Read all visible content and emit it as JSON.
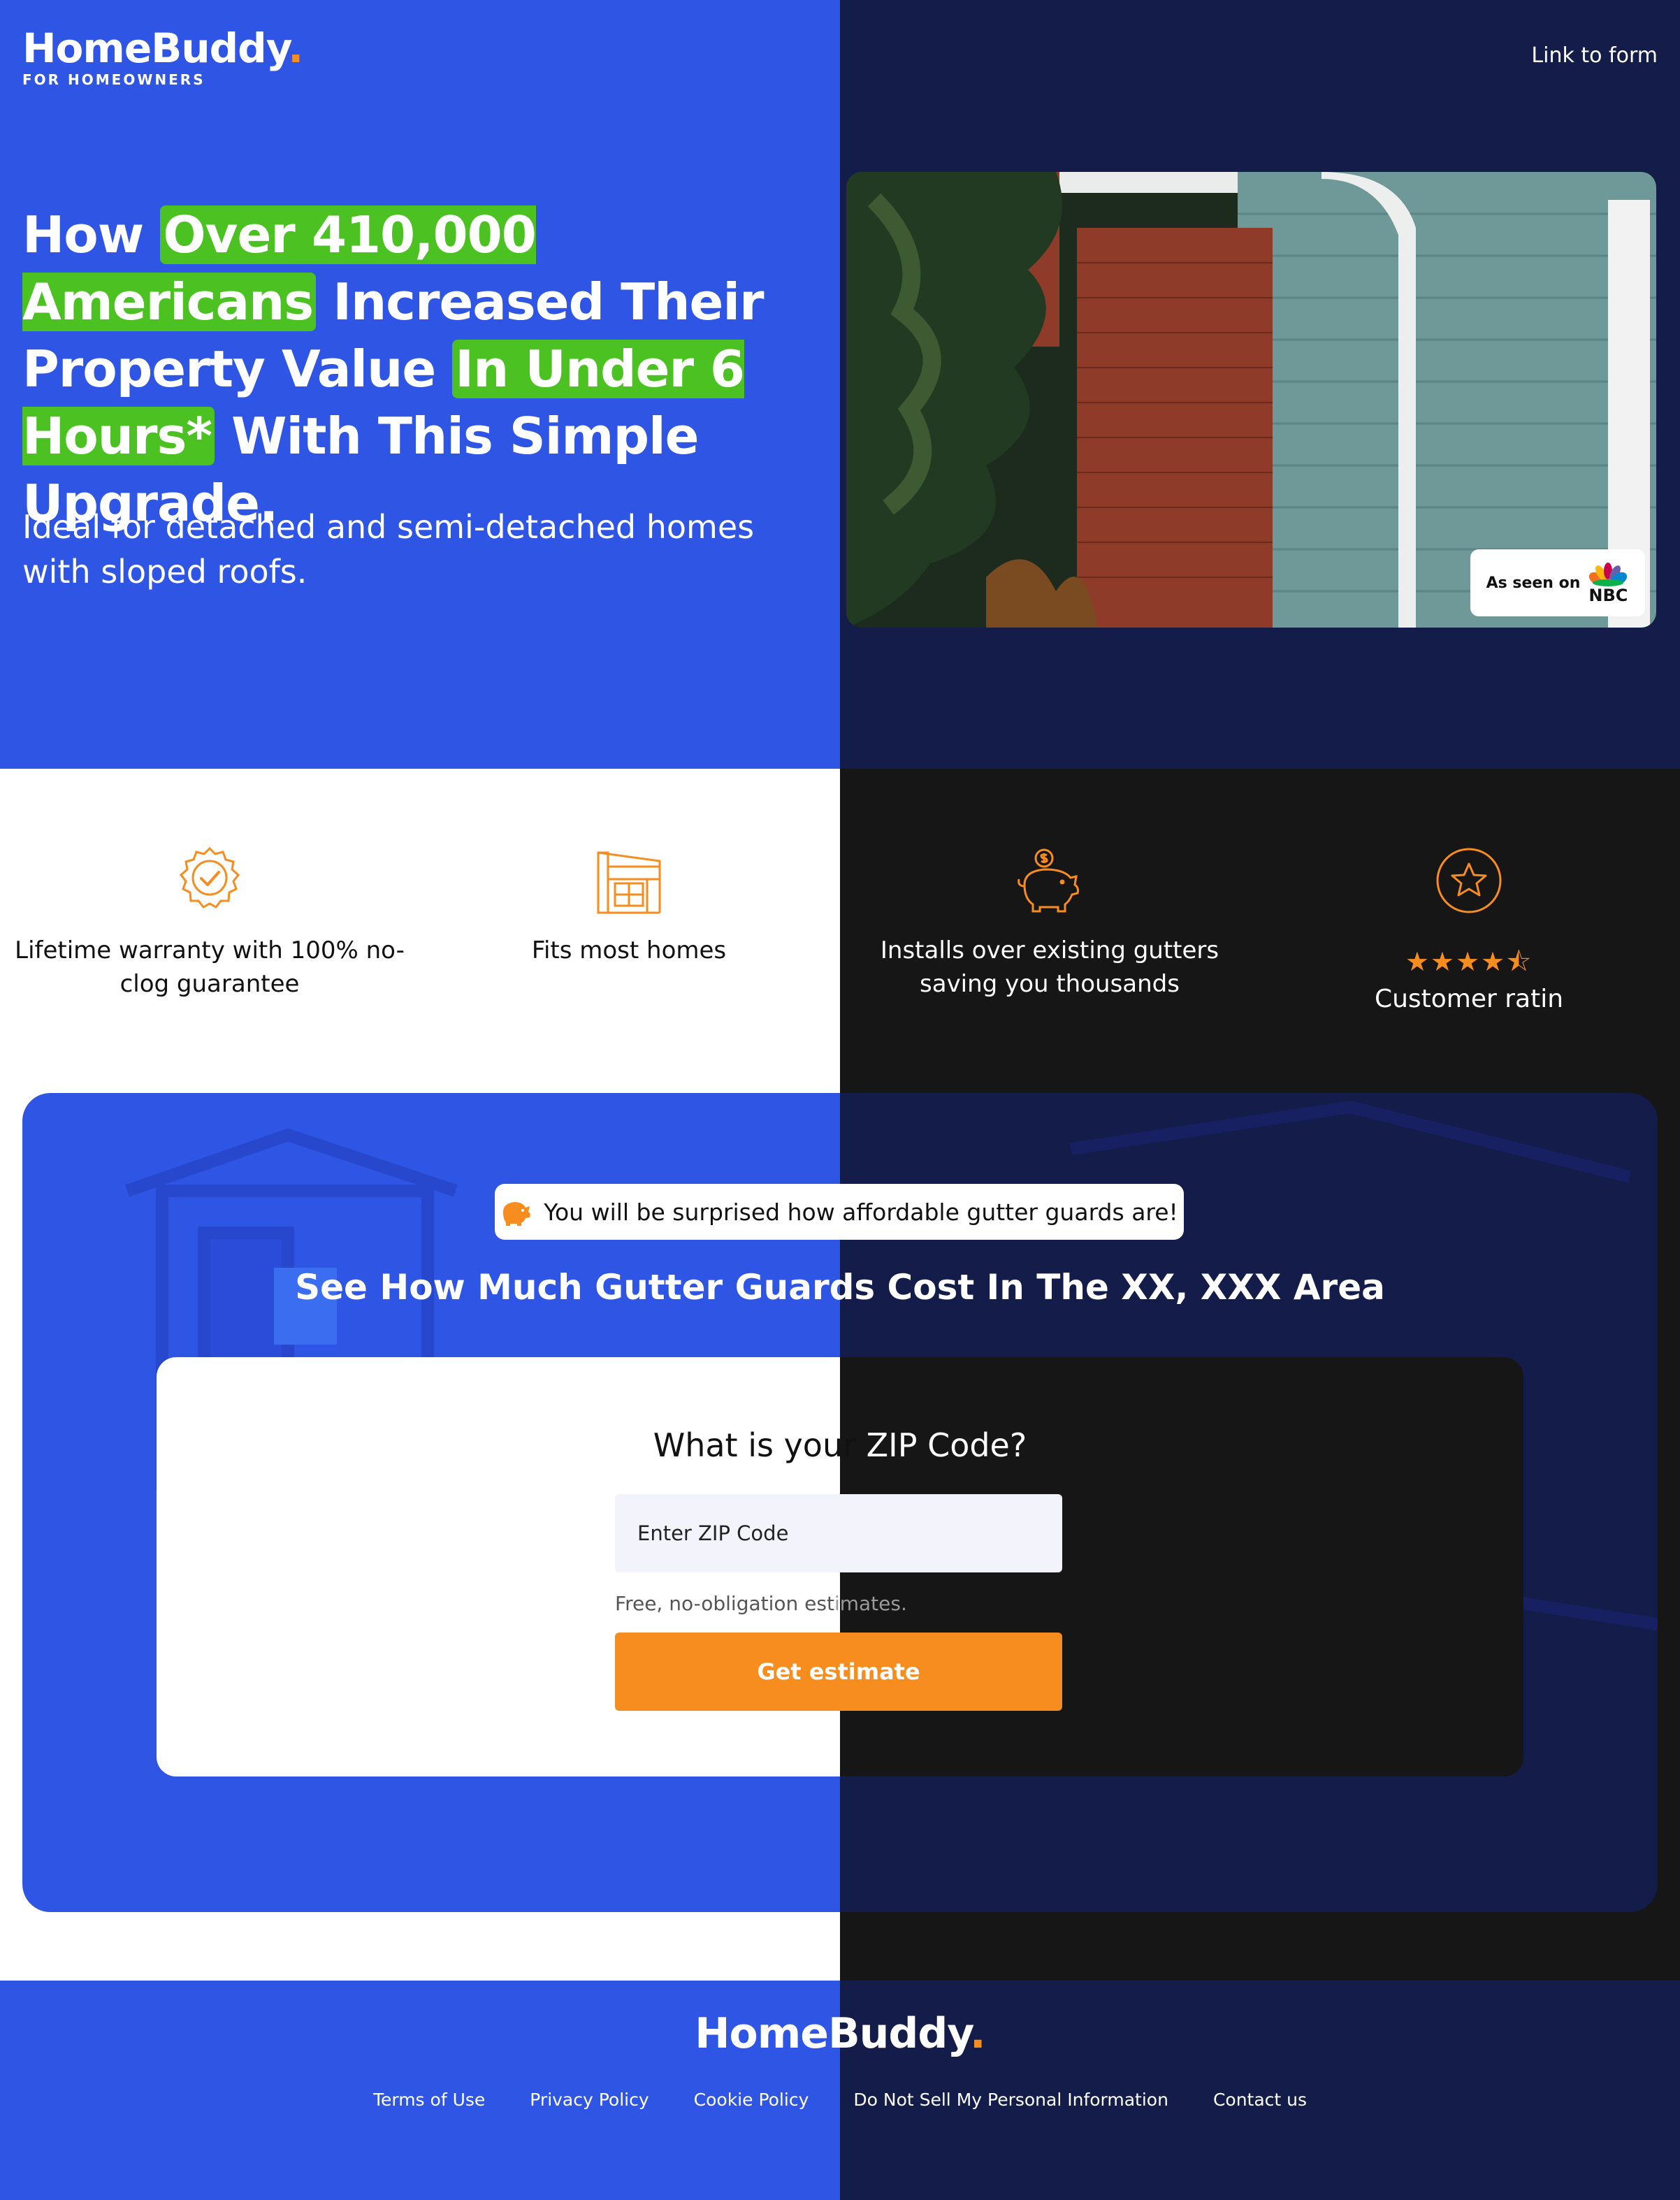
{
  "brand": {
    "name": "HomeBuddy",
    "dot": ".",
    "tagline": "FOR HOMEOWNERS",
    "accent_color": "#f78c1f",
    "primary_color": "#2f55e4",
    "highlight_color": "#4bc221"
  },
  "header": {
    "link_to_form": "Link to form"
  },
  "hero": {
    "headline_pre": "How ",
    "headline_highlight_1": "Over 410,000 Americans",
    "headline_mid": " Increased Their Property Value ",
    "headline_highlight_2": "In Under 6 Hours*",
    "headline_post": " With This Simple Upgrade.",
    "subtitle": "Ideal for detached and semi-detached homes with sloped roofs.",
    "badge": {
      "text": "As seen on",
      "logo_word": "NBC"
    }
  },
  "features": [
    {
      "icon": "badge-check-icon",
      "label": "Lifetime warranty with 100% no-clog guarantee"
    },
    {
      "icon": "house-icon",
      "label": "Fits most homes"
    },
    {
      "icon": "piggy-bank-icon",
      "label": "Installs over existing gutters saving you thousands"
    },
    {
      "icon": "star-circle-icon",
      "label": "Customer ratin",
      "rating": 4.5,
      "stars": "★★★★⯪"
    }
  ],
  "estimate": {
    "pill_text": "You will be surprised how affordable gutter guards are!",
    "title": "See How Much Gutter Guards Cost In The XX, XXX Area",
    "question_part_1": "What is your",
    "question_part_2": " ZIP Code?",
    "zip_placeholder": "Enter ZIP Code",
    "disclaimer_part_1": "Free, no-obligation est",
    "disclaimer_part_2": "imates.",
    "button_label": "Get estimate"
  },
  "footer": {
    "links": [
      "Terms of Use",
      "Privacy Policy",
      "Cookie Policy",
      "Do Not Sell My Personal Information",
      "Contact us"
    ]
  }
}
